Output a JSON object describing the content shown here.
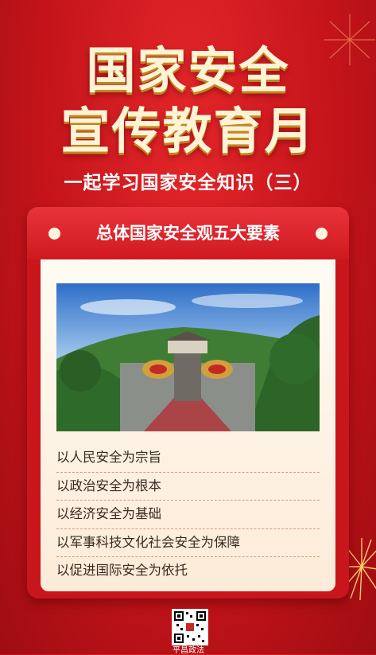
{
  "title": {
    "line1": "国家安全",
    "line2": "宣传教育月"
  },
  "subtitle": "一起学习国家安全知识（三）",
  "card": {
    "title": "总体国家安全观五大要素",
    "items": [
      "以人民安全为宗旨",
      "以政治安全为根本",
      "以经济安全为基础",
      "以军事科技文化社会安全为保障",
      "以促进国际安全为依托"
    ]
  },
  "footer": {
    "qr_label": "平昌政法"
  },
  "colors": {
    "background": "#c4141a",
    "title_text": "#fff3d6",
    "card_body": "#fffbf3"
  }
}
